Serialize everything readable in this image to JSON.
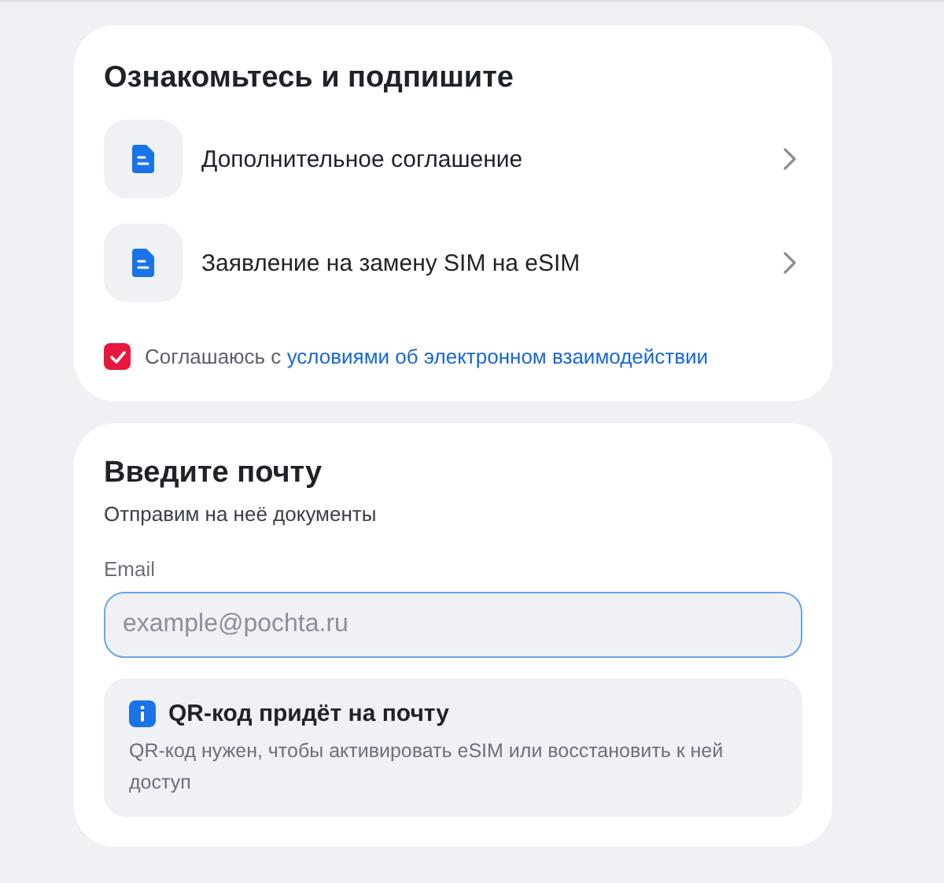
{
  "sign_card": {
    "title": "Ознакомьтесь и подпишите",
    "documents": [
      {
        "label": "Дополнительное соглашение"
      },
      {
        "label": "Заявление на замену SIM на eSIM"
      }
    ],
    "consent": {
      "checked": true,
      "text": "Соглашаюсь с",
      "link": "условиями об электронном взаимодействии"
    }
  },
  "email_card": {
    "title": "Введите почту",
    "subtitle": "Отправим на неё документы",
    "field": {
      "label": "Email",
      "placeholder": "example@pochta.ru",
      "focused": true
    },
    "info": {
      "title": "QR-код придёт на почту",
      "text": "QR-код нужен, чтобы активировать eSIM или восстановить к ней доступ"
    }
  }
}
